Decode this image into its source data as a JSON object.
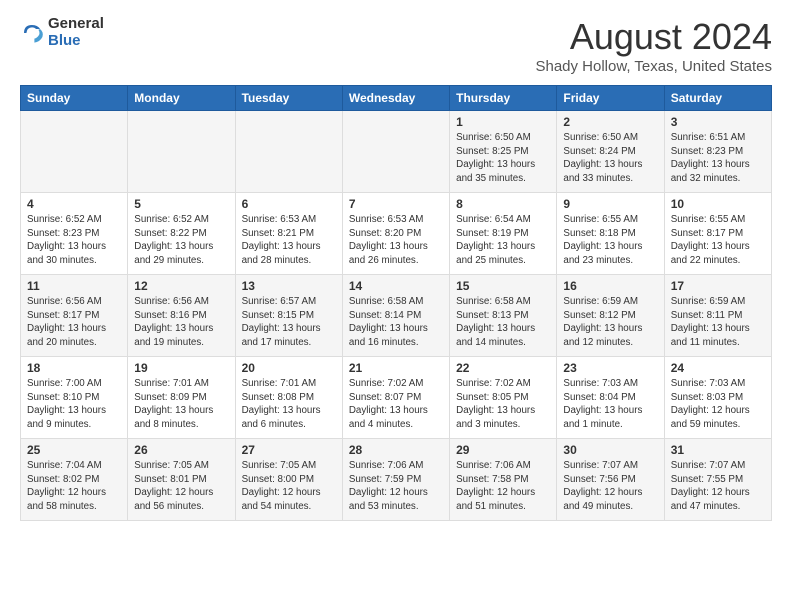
{
  "header": {
    "logo": {
      "general": "General",
      "blue": "Blue"
    },
    "title": "August 2024",
    "subtitle": "Shady Hollow, Texas, United States"
  },
  "days_of_week": [
    "Sunday",
    "Monday",
    "Tuesday",
    "Wednesday",
    "Thursday",
    "Friday",
    "Saturday"
  ],
  "weeks": [
    [
      {
        "day": "",
        "sunrise": "",
        "sunset": "",
        "daylight": ""
      },
      {
        "day": "",
        "sunrise": "",
        "sunset": "",
        "daylight": ""
      },
      {
        "day": "",
        "sunrise": "",
        "sunset": "",
        "daylight": ""
      },
      {
        "day": "",
        "sunrise": "",
        "sunset": "",
        "daylight": ""
      },
      {
        "day": "1",
        "sunrise": "Sunrise: 6:50 AM",
        "sunset": "Sunset: 8:25 PM",
        "daylight": "Daylight: 13 hours and 35 minutes."
      },
      {
        "day": "2",
        "sunrise": "Sunrise: 6:50 AM",
        "sunset": "Sunset: 8:24 PM",
        "daylight": "Daylight: 13 hours and 33 minutes."
      },
      {
        "day": "3",
        "sunrise": "Sunrise: 6:51 AM",
        "sunset": "Sunset: 8:23 PM",
        "daylight": "Daylight: 13 hours and 32 minutes."
      }
    ],
    [
      {
        "day": "4",
        "sunrise": "Sunrise: 6:52 AM",
        "sunset": "Sunset: 8:23 PM",
        "daylight": "Daylight: 13 hours and 30 minutes."
      },
      {
        "day": "5",
        "sunrise": "Sunrise: 6:52 AM",
        "sunset": "Sunset: 8:22 PM",
        "daylight": "Daylight: 13 hours and 29 minutes."
      },
      {
        "day": "6",
        "sunrise": "Sunrise: 6:53 AM",
        "sunset": "Sunset: 8:21 PM",
        "daylight": "Daylight: 13 hours and 28 minutes."
      },
      {
        "day": "7",
        "sunrise": "Sunrise: 6:53 AM",
        "sunset": "Sunset: 8:20 PM",
        "daylight": "Daylight: 13 hours and 26 minutes."
      },
      {
        "day": "8",
        "sunrise": "Sunrise: 6:54 AM",
        "sunset": "Sunset: 8:19 PM",
        "daylight": "Daylight: 13 hours and 25 minutes."
      },
      {
        "day": "9",
        "sunrise": "Sunrise: 6:55 AM",
        "sunset": "Sunset: 8:18 PM",
        "daylight": "Daylight: 13 hours and 23 minutes."
      },
      {
        "day": "10",
        "sunrise": "Sunrise: 6:55 AM",
        "sunset": "Sunset: 8:17 PM",
        "daylight": "Daylight: 13 hours and 22 minutes."
      }
    ],
    [
      {
        "day": "11",
        "sunrise": "Sunrise: 6:56 AM",
        "sunset": "Sunset: 8:17 PM",
        "daylight": "Daylight: 13 hours and 20 minutes."
      },
      {
        "day": "12",
        "sunrise": "Sunrise: 6:56 AM",
        "sunset": "Sunset: 8:16 PM",
        "daylight": "Daylight: 13 hours and 19 minutes."
      },
      {
        "day": "13",
        "sunrise": "Sunrise: 6:57 AM",
        "sunset": "Sunset: 8:15 PM",
        "daylight": "Daylight: 13 hours and 17 minutes."
      },
      {
        "day": "14",
        "sunrise": "Sunrise: 6:58 AM",
        "sunset": "Sunset: 8:14 PM",
        "daylight": "Daylight: 13 hours and 16 minutes."
      },
      {
        "day": "15",
        "sunrise": "Sunrise: 6:58 AM",
        "sunset": "Sunset: 8:13 PM",
        "daylight": "Daylight: 13 hours and 14 minutes."
      },
      {
        "day": "16",
        "sunrise": "Sunrise: 6:59 AM",
        "sunset": "Sunset: 8:12 PM",
        "daylight": "Daylight: 13 hours and 12 minutes."
      },
      {
        "day": "17",
        "sunrise": "Sunrise: 6:59 AM",
        "sunset": "Sunset: 8:11 PM",
        "daylight": "Daylight: 13 hours and 11 minutes."
      }
    ],
    [
      {
        "day": "18",
        "sunrise": "Sunrise: 7:00 AM",
        "sunset": "Sunset: 8:10 PM",
        "daylight": "Daylight: 13 hours and 9 minutes."
      },
      {
        "day": "19",
        "sunrise": "Sunrise: 7:01 AM",
        "sunset": "Sunset: 8:09 PM",
        "daylight": "Daylight: 13 hours and 8 minutes."
      },
      {
        "day": "20",
        "sunrise": "Sunrise: 7:01 AM",
        "sunset": "Sunset: 8:08 PM",
        "daylight": "Daylight: 13 hours and 6 minutes."
      },
      {
        "day": "21",
        "sunrise": "Sunrise: 7:02 AM",
        "sunset": "Sunset: 8:07 PM",
        "daylight": "Daylight: 13 hours and 4 minutes."
      },
      {
        "day": "22",
        "sunrise": "Sunrise: 7:02 AM",
        "sunset": "Sunset: 8:05 PM",
        "daylight": "Daylight: 13 hours and 3 minutes."
      },
      {
        "day": "23",
        "sunrise": "Sunrise: 7:03 AM",
        "sunset": "Sunset: 8:04 PM",
        "daylight": "Daylight: 13 hours and 1 minute."
      },
      {
        "day": "24",
        "sunrise": "Sunrise: 7:03 AM",
        "sunset": "Sunset: 8:03 PM",
        "daylight": "Daylight: 12 hours and 59 minutes."
      }
    ],
    [
      {
        "day": "25",
        "sunrise": "Sunrise: 7:04 AM",
        "sunset": "Sunset: 8:02 PM",
        "daylight": "Daylight: 12 hours and 58 minutes."
      },
      {
        "day": "26",
        "sunrise": "Sunrise: 7:05 AM",
        "sunset": "Sunset: 8:01 PM",
        "daylight": "Daylight: 12 hours and 56 minutes."
      },
      {
        "day": "27",
        "sunrise": "Sunrise: 7:05 AM",
        "sunset": "Sunset: 8:00 PM",
        "daylight": "Daylight: 12 hours and 54 minutes."
      },
      {
        "day": "28",
        "sunrise": "Sunrise: 7:06 AM",
        "sunset": "Sunset: 7:59 PM",
        "daylight": "Daylight: 12 hours and 53 minutes."
      },
      {
        "day": "29",
        "sunrise": "Sunrise: 7:06 AM",
        "sunset": "Sunset: 7:58 PM",
        "daylight": "Daylight: 12 hours and 51 minutes."
      },
      {
        "day": "30",
        "sunrise": "Sunrise: 7:07 AM",
        "sunset": "Sunset: 7:56 PM",
        "daylight": "Daylight: 12 hours and 49 minutes."
      },
      {
        "day": "31",
        "sunrise": "Sunrise: 7:07 AM",
        "sunset": "Sunset: 7:55 PM",
        "daylight": "Daylight: 12 hours and 47 minutes."
      }
    ]
  ]
}
